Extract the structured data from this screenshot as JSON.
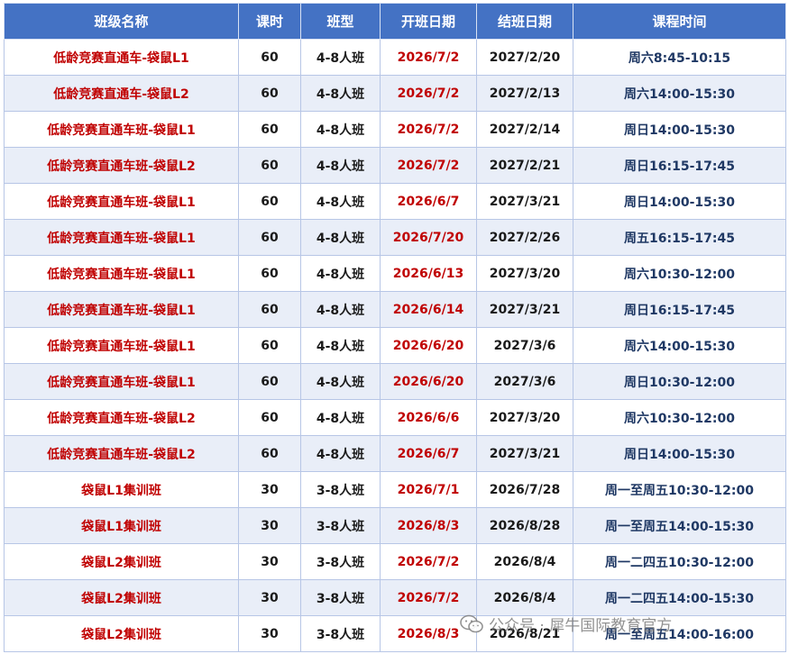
{
  "headers": [
    "班级名称",
    "课时",
    "班型",
    "开班日期",
    "结班日期",
    "课程时间"
  ],
  "rows": [
    {
      "name": "低龄竞赛直通车-袋鼠L1",
      "hours": "60",
      "size": "4-8人班",
      "start": "2026/7/2",
      "end": "2027/2/20",
      "time": "周六8:45-10:15"
    },
    {
      "name": "低龄竞赛直通车-袋鼠L2",
      "hours": "60",
      "size": "4-8人班",
      "start": "2026/7/2",
      "end": "2027/2/13",
      "time": "周六14:00-15:30"
    },
    {
      "name": "低龄竞赛直通车班-袋鼠L1",
      "hours": "60",
      "size": "4-8人班",
      "start": "2026/7/2",
      "end": "2027/2/14",
      "time": "周日14:00-15:30"
    },
    {
      "name": "低龄竞赛直通车班-袋鼠L2",
      "hours": "60",
      "size": "4-8人班",
      "start": "2026/7/2",
      "end": "2027/2/21",
      "time": "周日16:15-17:45"
    },
    {
      "name": "低龄竞赛直通车班-袋鼠L1",
      "hours": "60",
      "size": "4-8人班",
      "start": "2026/6/7",
      "end": "2027/3/21",
      "time": "周日14:00-15:30"
    },
    {
      "name": "低龄竞赛直通车班-袋鼠L1",
      "hours": "60",
      "size": "4-8人班",
      "start": "2026/7/20",
      "end": "2027/2/26",
      "time": "周五16:15-17:45"
    },
    {
      "name": "低龄竞赛直通车班-袋鼠L1",
      "hours": "60",
      "size": "4-8人班",
      "start": "2026/6/13",
      "end": "2027/3/20",
      "time": "周六10:30-12:00"
    },
    {
      "name": "低龄竞赛直通车班-袋鼠L1",
      "hours": "60",
      "size": "4-8人班",
      "start": "2026/6/14",
      "end": "2027/3/21",
      "time": "周日16:15-17:45"
    },
    {
      "name": "低龄竞赛直通车班-袋鼠L1",
      "hours": "60",
      "size": "4-8人班",
      "start": "2026/6/20",
      "end": "2027/3/6",
      "time": "周六14:00-15:30"
    },
    {
      "name": "低龄竞赛直通车班-袋鼠L1",
      "hours": "60",
      "size": "4-8人班",
      "start": "2026/6/20",
      "end": "2027/3/6",
      "time": "周日10:30-12:00"
    },
    {
      "name": "低龄竞赛直通车班-袋鼠L2",
      "hours": "60",
      "size": "4-8人班",
      "start": "2026/6/6",
      "end": "2027/3/20",
      "time": "周六10:30-12:00"
    },
    {
      "name": "低龄竞赛直通车班-袋鼠L2",
      "hours": "60",
      "size": "4-8人班",
      "start": "2026/6/7",
      "end": "2027/3/21",
      "time": "周日14:00-15:30"
    },
    {
      "name": "袋鼠L1集训班",
      "hours": "30",
      "size": "3-8人班",
      "start": "2026/7/1",
      "end": "2026/7/28",
      "time": "周一至周五10:30-12:00"
    },
    {
      "name": "袋鼠L1集训班",
      "hours": "30",
      "size": "3-8人班",
      "start": "2026/8/3",
      "end": "2026/8/28",
      "time": "周一至周五14:00-15:30"
    },
    {
      "name": "袋鼠L2集训班",
      "hours": "30",
      "size": "3-8人班",
      "start": "2026/7/2",
      "end": "2026/8/4",
      "time": "周一二四五10:30-12:00"
    },
    {
      "name": "袋鼠L2集训班",
      "hours": "30",
      "size": "3-8人班",
      "start": "2026/7/2",
      "end": "2026/8/4",
      "time": "周一二四五14:00-15:30"
    },
    {
      "name": "袋鼠L2集训班",
      "hours": "30",
      "size": "3-8人班",
      "start": "2026/8/3",
      "end": "2026/8/21",
      "time": "周一至周五14:00-16:00"
    }
  ],
  "watermark": {
    "text": "公众号 · 犀牛国际教育官方",
    "icon": "wechat-icon"
  },
  "colors": {
    "header_bg": "#4472c4",
    "header_text": "#ffffff",
    "alt_row_bg": "#e9eef8",
    "accent_red": "#c00000",
    "time_navy": "#1f3864"
  }
}
